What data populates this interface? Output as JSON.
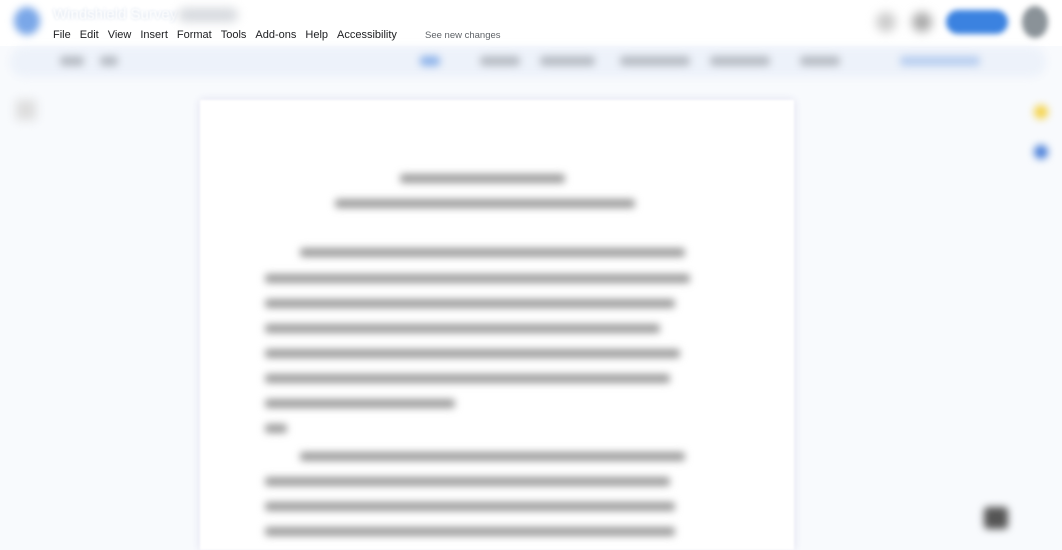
{
  "app": {
    "title": "Windshield Survey"
  },
  "menu": {
    "items": [
      "File",
      "Edit",
      "View",
      "Insert",
      "Format",
      "Tools",
      "Add-ons",
      "Help",
      "Accessibility"
    ],
    "see_changes": "See new changes"
  },
  "colors": {
    "share_button": "#3b82e0",
    "logo": "#7aa7e8",
    "toolbar": "#edf2fa"
  },
  "icons": {
    "logo": "docs-logo-icon",
    "avatar": "account-avatar",
    "share": "share-button"
  }
}
